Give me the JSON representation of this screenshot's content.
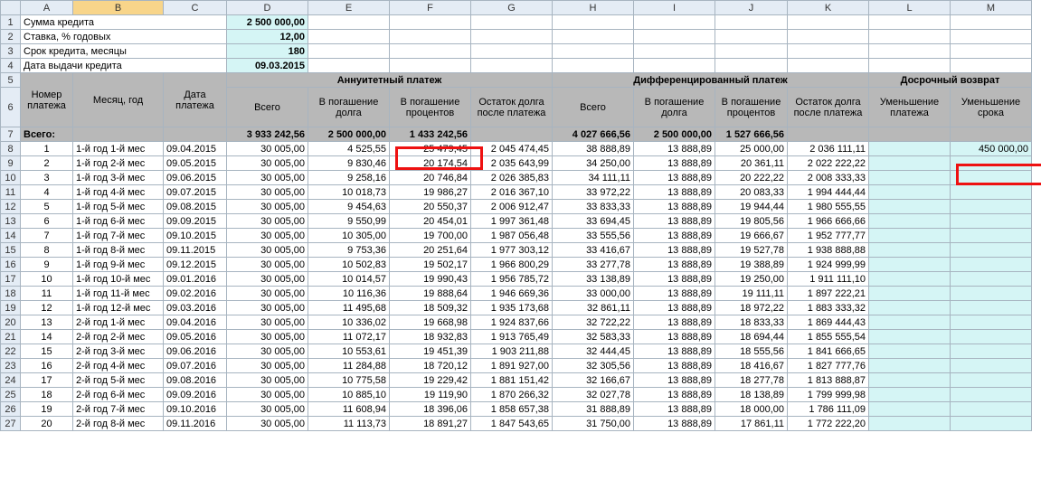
{
  "cols": [
    "",
    "A",
    "B",
    "C",
    "D",
    "E",
    "F",
    "G",
    "H",
    "I",
    "J",
    "K",
    "L",
    "M"
  ],
  "params": {
    "amount_label": "Сумма кредита",
    "amount_value": "2 500 000,00",
    "rate_label": "Ставка, % годовых",
    "rate_value": "12,00",
    "term_label": "Срок кредита, месяцы",
    "term_value": "180",
    "date_label": "Дата выдачи кредита",
    "date_value": "09.03.2015"
  },
  "headers": {
    "payment_no": "Номер платежа",
    "month_year": "Месяц, год",
    "pay_date": "Дата платежа",
    "annuity_group": "Аннуитетный платеж",
    "diff_group": "Дифференцированный платеж",
    "early_group": "Досрочный возврат",
    "total": "Всего",
    "principal": "В погашение долга",
    "interest": "В погашение процентов",
    "balance_after_hdr": "Остаток долга после платежа",
    "balance_after_hdr2": "Остаток долга после платежа",
    "reduce_payment": "Уменьшение платежа",
    "reduce_term": "Уменьшение срока"
  },
  "totals_label": "Всего:",
  "totals": {
    "ann_total": "3 933 242,56",
    "ann_principal": "2 500 000,00",
    "ann_interest": "1 433 242,56",
    "ann_balance": "",
    "diff_total": "4 027 666,56",
    "diff_principal": "2 500 000,00",
    "diff_interest": "1 527 666,56",
    "diff_balance": "",
    "early_reduce_term_first": "450 000,00"
  },
  "rows": [
    {
      "n": "1",
      "my": "1-й год 1-й мес",
      "d": "09.04.2015",
      "at": "30 005,00",
      "ap": "4 525,55",
      "ai": "25 479,45",
      "ab": "2 045 474,45",
      "dt": "38 888,89",
      "dp": "13 888,89",
      "di": "25 000,00",
      "db": "2 036 111,11"
    },
    {
      "n": "2",
      "my": "1-й год 2-й мес",
      "d": "09.05.2015",
      "at": "30 005,00",
      "ap": "9 830,46",
      "ai": "20 174,54",
      "ab": "2 035 643,99",
      "dt": "34 250,00",
      "dp": "13 888,89",
      "di": "20 361,11",
      "db": "2 022 222,22"
    },
    {
      "n": "3",
      "my": "1-й год 3-й мес",
      "d": "09.06.2015",
      "at": "30 005,00",
      "ap": "9 258,16",
      "ai": "20 746,84",
      "ab": "2 026 385,83",
      "dt": "34 111,11",
      "dp": "13 888,89",
      "di": "20 222,22",
      "db": "2 008 333,33"
    },
    {
      "n": "4",
      "my": "1-й год 4-й мес",
      "d": "09.07.2015",
      "at": "30 005,00",
      "ap": "10 018,73",
      "ai": "19 986,27",
      "ab": "2 016 367,10",
      "dt": "33 972,22",
      "dp": "13 888,89",
      "di": "20 083,33",
      "db": "1 994 444,44"
    },
    {
      "n": "5",
      "my": "1-й год 5-й мес",
      "d": "09.08.2015",
      "at": "30 005,00",
      "ap": "9 454,63",
      "ai": "20 550,37",
      "ab": "2 006 912,47",
      "dt": "33 833,33",
      "dp": "13 888,89",
      "di": "19 944,44",
      "db": "1 980 555,55"
    },
    {
      "n": "6",
      "my": "1-й год 6-й мес",
      "d": "09.09.2015",
      "at": "30 005,00",
      "ap": "9 550,99",
      "ai": "20 454,01",
      "ab": "1 997 361,48",
      "dt": "33 694,45",
      "dp": "13 888,89",
      "di": "19 805,56",
      "db": "1 966 666,66"
    },
    {
      "n": "7",
      "my": "1-й год 7-й мес",
      "d": "09.10.2015",
      "at": "30 005,00",
      "ap": "10 305,00",
      "ai": "19 700,00",
      "ab": "1 987 056,48",
      "dt": "33 555,56",
      "dp": "13 888,89",
      "di": "19 666,67",
      "db": "1 952 777,77"
    },
    {
      "n": "8",
      "my": "1-й год 8-й мес",
      "d": "09.11.2015",
      "at": "30 005,00",
      "ap": "9 753,36",
      "ai": "20 251,64",
      "ab": "1 977 303,12",
      "dt": "33 416,67",
      "dp": "13 888,89",
      "di": "19 527,78",
      "db": "1 938 888,88"
    },
    {
      "n": "9",
      "my": "1-й год 9-й мес",
      "d": "09.12.2015",
      "at": "30 005,00",
      "ap": "10 502,83",
      "ai": "19 502,17",
      "ab": "1 966 800,29",
      "dt": "33 277,78",
      "dp": "13 888,89",
      "di": "19 388,89",
      "db": "1 924 999,99"
    },
    {
      "n": "10",
      "my": "1-й год 10-й мес",
      "d": "09.01.2016",
      "at": "30 005,00",
      "ap": "10 014,57",
      "ai": "19 990,43",
      "ab": "1 956 785,72",
      "dt": "33 138,89",
      "dp": "13 888,89",
      "di": "19 250,00",
      "db": "1 911 111,10"
    },
    {
      "n": "11",
      "my": "1-й год 11-й мес",
      "d": "09.02.2016",
      "at": "30 005,00",
      "ap": "10 116,36",
      "ai": "19 888,64",
      "ab": "1 946 669,36",
      "dt": "33 000,00",
      "dp": "13 888,89",
      "di": "19 111,11",
      "db": "1 897 222,21"
    },
    {
      "n": "12",
      "my": "1-й год 12-й мес",
      "d": "09.03.2016",
      "at": "30 005,00",
      "ap": "11 495,68",
      "ai": "18 509,32",
      "ab": "1 935 173,68",
      "dt": "32 861,11",
      "dp": "13 888,89",
      "di": "18 972,22",
      "db": "1 883 333,32"
    },
    {
      "n": "13",
      "my": "2-й год 1-й мес",
      "d": "09.04.2016",
      "at": "30 005,00",
      "ap": "10 336,02",
      "ai": "19 668,98",
      "ab": "1 924 837,66",
      "dt": "32 722,22",
      "dp": "13 888,89",
      "di": "18 833,33",
      "db": "1 869 444,43"
    },
    {
      "n": "14",
      "my": "2-й год 2-й мес",
      "d": "09.05.2016",
      "at": "30 005,00",
      "ap": "11 072,17",
      "ai": "18 932,83",
      "ab": "1 913 765,49",
      "dt": "32 583,33",
      "dp": "13 888,89",
      "di": "18 694,44",
      "db": "1 855 555,54"
    },
    {
      "n": "15",
      "my": "2-й год 3-й мес",
      "d": "09.06.2016",
      "at": "30 005,00",
      "ap": "10 553,61",
      "ai": "19 451,39",
      "ab": "1 903 211,88",
      "dt": "32 444,45",
      "dp": "13 888,89",
      "di": "18 555,56",
      "db": "1 841 666,65"
    },
    {
      "n": "16",
      "my": "2-й год 4-й мес",
      "d": "09.07.2016",
      "at": "30 005,00",
      "ap": "11 284,88",
      "ai": "18 720,12",
      "ab": "1 891 927,00",
      "dt": "32 305,56",
      "dp": "13 888,89",
      "di": "18 416,67",
      "db": "1 827 777,76"
    },
    {
      "n": "17",
      "my": "2-й год 5-й мес",
      "d": "09.08.2016",
      "at": "30 005,00",
      "ap": "10 775,58",
      "ai": "19 229,42",
      "ab": "1 881 151,42",
      "dt": "32 166,67",
      "dp": "13 888,89",
      "di": "18 277,78",
      "db": "1 813 888,87"
    },
    {
      "n": "18",
      "my": "2-й год 6-й мес",
      "d": "09.09.2016",
      "at": "30 005,00",
      "ap": "10 885,10",
      "ai": "19 119,90",
      "ab": "1 870 266,32",
      "dt": "32 027,78",
      "dp": "13 888,89",
      "di": "18 138,89",
      "db": "1 799 999,98"
    },
    {
      "n": "19",
      "my": "2-й год 7-й мес",
      "d": "09.10.2016",
      "at": "30 005,00",
      "ap": "11 608,94",
      "ai": "18 396,06",
      "ab": "1 858 657,38",
      "dt": "31 888,89",
      "dp": "13 888,89",
      "di": "18 000,00",
      "db": "1 786 111,09"
    },
    {
      "n": "20",
      "my": "2-й год 8-й мес",
      "d": "09.11.2016",
      "at": "30 005,00",
      "ap": "11 113,73",
      "ai": "18 891,27",
      "ab": "1 847 543,65",
      "dt": "31 750,00",
      "dp": "13 888,89",
      "di": "17 861,11",
      "db": "1 772 222,20"
    }
  ]
}
